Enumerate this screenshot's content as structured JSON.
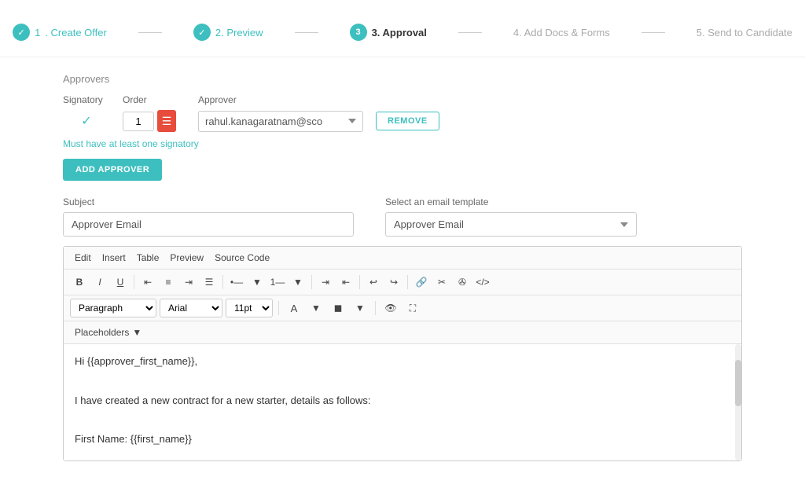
{
  "stepper": {
    "steps": [
      {
        "id": "create-offer",
        "number": "1",
        "label": "Create Offer",
        "state": "completed"
      },
      {
        "id": "preview",
        "number": "2",
        "label": "Preview",
        "state": "completed"
      },
      {
        "id": "approval",
        "number": "3",
        "label": "Approval",
        "state": "active"
      },
      {
        "id": "add-docs",
        "number": "4",
        "label": "Add Docs & Forms",
        "state": "inactive"
      },
      {
        "id": "send-candidate",
        "number": "5",
        "label": "Send to Candidate",
        "state": "inactive"
      }
    ]
  },
  "section": {
    "approvers_label": "Approvers",
    "col_signatory": "Signatory",
    "col_order": "Order",
    "col_approver": "Approver",
    "order_value": "1",
    "approver_value": "rahul.kanagaratnam@sco",
    "remove_label": "REMOVE",
    "must_have_note": "Must have at least one signatory",
    "add_approver_label": "ADD APPROVER"
  },
  "subject": {
    "label": "Subject",
    "value": "Approver Email"
  },
  "email_template": {
    "label": "Select an email template",
    "value": "Approver Email"
  },
  "editor": {
    "menu_items": [
      "Edit",
      "Insert",
      "Table",
      "Preview",
      "Source Code"
    ],
    "toolbar_buttons": [
      "B",
      "I",
      "U",
      "align-left",
      "align-center",
      "align-right",
      "align-justify",
      "list-ul",
      "list-chevron",
      "list-ol",
      "list-chevron2",
      "indent-right",
      "indent-left",
      "undo",
      "redo",
      "link",
      "unlink",
      "image",
      "code"
    ],
    "format_paragraph": "Paragraph",
    "format_font": "Arial",
    "format_size": "11pt",
    "placeholders_label": "Placeholders",
    "body_lines": [
      "Hi {{approver_first_name}},",
      "",
      "I have created a new contract for a new starter, details as follows:",
      "",
      "First Name: {{first_name}}"
    ]
  }
}
